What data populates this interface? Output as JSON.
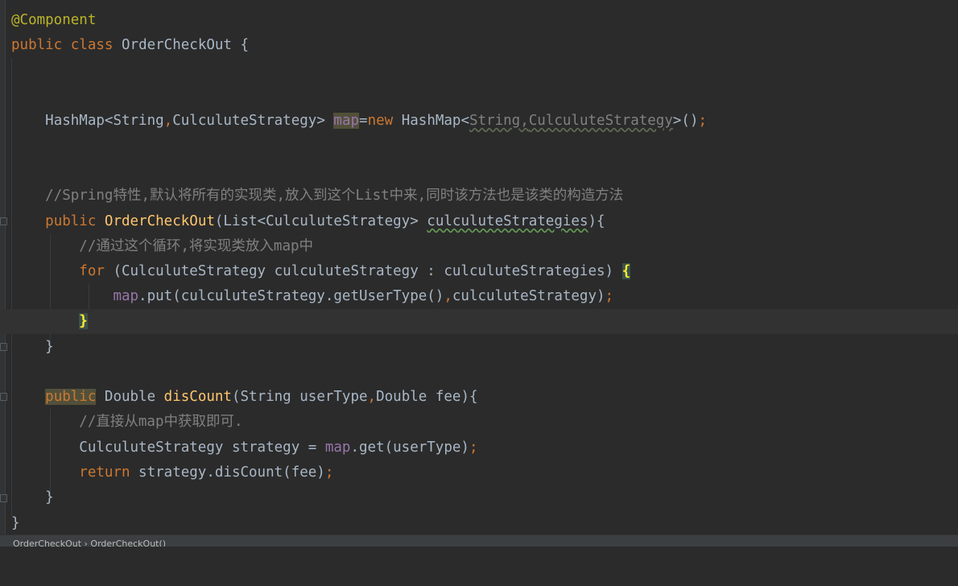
{
  "code": {
    "l1_annotation": "@Component",
    "l2_public": "public",
    "l2_class": "class",
    "l2_name": "OrderCheckOut {",
    "l5_type": "HashMap<String",
    "l5_comma1": ",",
    "l5_type2": "CulculuteStrategy> ",
    "l5_map": "map",
    "l5_eq": "=",
    "l5_new": "new",
    "l5_ctor": " HashMap<",
    "l5_gen1": "String",
    "l5_comma2": ",",
    "l5_gen2": "CulculuteStrategy",
    "l5_close": ">()",
    "l5_semi": ";",
    "l8_comment": "//Spring特性,默认将所有的实现类,放入到这个List中来,同时该方法也是该类的构造方法",
    "l9_public": "public",
    "l9_ctor": "OrderCheckOut",
    "l9_params": "(List<CulculuteStrategy> ",
    "l9_param_name": "culculuteStrategies",
    "l9_end": "){",
    "l10_comment": "//通过这个循环,将实现类放入map中",
    "l11_for": "for",
    "l11_body": " (CulculuteStrategy culculuteStrategy : culculuteStrategies) ",
    "l11_brace": "{",
    "l12_map": "map",
    "l12_call": ".put(culculuteStrategy.getUserType()",
    "l12_comma": ",",
    "l12_arg": "culculuteStrategy)",
    "l12_semi": ";",
    "l13_brace": "}",
    "l14_brace": "}",
    "l16_public": "public",
    "l16_type": " Double ",
    "l16_method": "disCount",
    "l16_params1": "(String userType",
    "l16_comma": ",",
    "l16_params2": "Double fee){",
    "l17_comment": "//直接从map中获取即可.",
    "l18_decl": "CulculuteStrategy strategy = ",
    "l18_map": "map",
    "l18_call": ".get(userType)",
    "l18_semi": ";",
    "l19_return": "return",
    "l19_expr": " strategy.disCount(fee)",
    "l19_semi": ";",
    "l20_brace": "}",
    "l21_brace": "}"
  },
  "statusbar": {
    "breadcrumb": "OrderCheckOut  ›  OrderCheckOut()"
  }
}
